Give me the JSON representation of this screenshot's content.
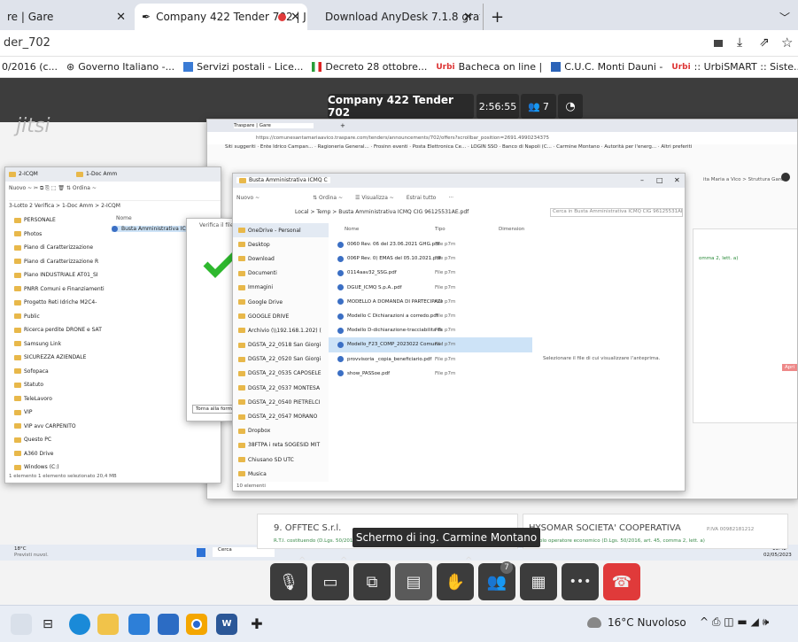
{
  "browser": {
    "tabs": [
      {
        "label": "re | Gare"
      },
      {
        "label": "Company 422 Tender 702 | J"
      },
      {
        "label": "Download AnyDesk 7.1.8 gratis"
      }
    ],
    "address": "der_702",
    "bookmarks": [
      "0/2016 (c...",
      "Governo Italiano -...",
      "Servizi postali - Lice...",
      "Decreto 28 ottobre...",
      "Bacheca on line |",
      "C.U.C. Monti Dauni -",
      ":: UrbiSMART :: Siste..."
    ]
  },
  "meeting": {
    "logo": "jitsi",
    "title": "Company 422 Tender 702",
    "timer": "2:56:55",
    "participants": "7",
    "participants_badge": "7",
    "tooltip": "Schermo di ing. Carmine Montano"
  },
  "shared": {
    "inner_tabs": [
      "Traspare | Gare"
    ],
    "inner_url": "https://comunesantamariaavico.traspare.com/tenders/announcements/702/offers?scrollbar_position=2691.4990234375",
    "inner_bookmarks": "Siti suggeriti · Ente Idrico Campan... · Ragioneria General... · Frosinn eventi · Posta Elettronica Ce... · LOGIN SSO · Banco di Napoli (C... · Carmine Montano · Autorità per l'energ... · Altri preferiti",
    "right_breadcrumb": "ita Maria a Vico > Struttura Gare",
    "right_link": "omma 2, lett. a)",
    "right_button": "Apri",
    "card1_title": "9. OFFTEC S.r.l.",
    "card1_sub": "R.T.I. costituendo (D.Lgs. 50/2016, art. 45, comma 2, lett. e)",
    "card2_title": "HYSOMAR SOCIETA' COOPERATIVA",
    "card2_code": "P.IVA 00982181212",
    "card2_sub": "Singolo operatore economico (D.Lgs. 50/2016, art. 45, comma 2, lett. a)",
    "weather_mini": "18°C",
    "weather_mini2": "Previsti nuvol.",
    "search_mini": "Cerca",
    "clock_mini": "13:42",
    "date_mini": "02/05/2023"
  },
  "explorer1": {
    "tabs": [
      "2-ICQM",
      "1-Doc Amm"
    ],
    "toolbar": "Nuovo ~ ✂ ⧉ ⎘ ⬚ 🗑 ⇅ Ordina ~",
    "path": "3-Lotto 2 Verifica > 1-Doc Amm > 2-ICQM",
    "col_name": "Nome",
    "items": [
      "PERSONALE",
      "Photos",
      "Piano di Caratterizzazione",
      "Piano di Caratterizzazione R",
      "Piano INDUSTRIALE AT01_SI",
      "PNRR Comuni e Finanziamenti",
      "Progetto Reti Idriche M2C4-",
      "Public",
      "Ricerca perdite DRONE e SAT",
      "Samsung Link",
      "SICUREZZA AZIENDALE",
      "Sofopaca",
      "Statuto",
      "TeleLavoro",
      "VIP",
      "VIP avv CARPENITO",
      "Questo PC",
      "A360 Drive",
      "Windows (C:)"
    ],
    "file": "Busta Amministrativa ICMQ C",
    "status": "1 elemento   1 elemento selezionato  20,4 MB"
  },
  "verify": {
    "label": "Verifica il file",
    "back_button": "Torna alla form"
  },
  "explorer2": {
    "tab": "Busta Amministrativa ICMQ C",
    "toolbar_new": "Nuovo ~",
    "toolbar_sort": "⇅ Ordina ~",
    "toolbar_view": "☰ Visualizza ~",
    "toolbar_extract": "Estrai tutto",
    "toolbar_more": "···",
    "path": "Local > Temp > Busta Amministrativa ICMQ CIG 96125531AE.pdf",
    "search": "Cerca in Busta Amministrativa ICMQ CIG 96125531AE.pdf",
    "nav": [
      "OneDrive - Personal",
      "Desktop",
      "Download",
      "Documenti",
      "Immagini",
      "Google Drive",
      "GOOGLE DRIVE",
      "Archivio (\\\\192.168.1.202) (",
      "DGSTA_22_0518 San Giorgi",
      "DGSTA_22_0520 San Giorgi",
      "DGSTA_22_0535 CAPOSELE",
      "DGSTA_22_0537 MONTESA",
      "DGSTA_22_0540 PIETRELCI",
      "DGSTA_22_0547 MORANO",
      "Dropbox",
      "38FTPA i reta SOGESID MIT",
      "Chiusano SD UTC",
      "Musica"
    ],
    "col_name": "Nome",
    "col_type": "Tipo",
    "col_dim": "Dimension",
    "files": [
      {
        "name": "0060 Rev. 06 del 23.06.2021 GHG.pdf",
        "type": "File p7m"
      },
      {
        "name": "006P Rev. 0) EMAS  del 05.10.2021.pdf",
        "type": "File p7m"
      },
      {
        "name": "0114aav32_SSG.pdf",
        "type": "File p7m"
      },
      {
        "name": "DGUE_ICMQ S.p.A..pdf",
        "type": "File p7m"
      },
      {
        "name": "MODELLO A DOMANDA DI PARTECIPAZIONE...",
        "type": "File p7m"
      },
      {
        "name": "Modello C Dichiarazioni a corredo.pdf",
        "type": "File p7m"
      },
      {
        "name": "Modello D-dichiarazione-tracciabilita-flussi-fi...",
        "type": "File p7m"
      },
      {
        "name": "Modello_F23_COMP_2023022 Comuna Santa ...",
        "type": "File p7m"
      },
      {
        "name": "provvisoria _copia_beneficiario.pdf",
        "type": "File p7m"
      },
      {
        "name": "show_PASSoe.pdf",
        "type": "File p7m"
      }
    ],
    "preview_hint": "Selezionare il file di cui visualizzare l'anteprima.",
    "status": "10 elementi"
  },
  "taskbar": {
    "weather": "16°C Nuvoloso",
    "tray": "^ ⎙ ◫ ▬ ◢ 🕪"
  },
  "colors": {
    "accent": "#1e6fd9",
    "hangup": "#e03a3a",
    "check": "#2eb82e",
    "jitsi_bar": "#2a2a2a"
  }
}
